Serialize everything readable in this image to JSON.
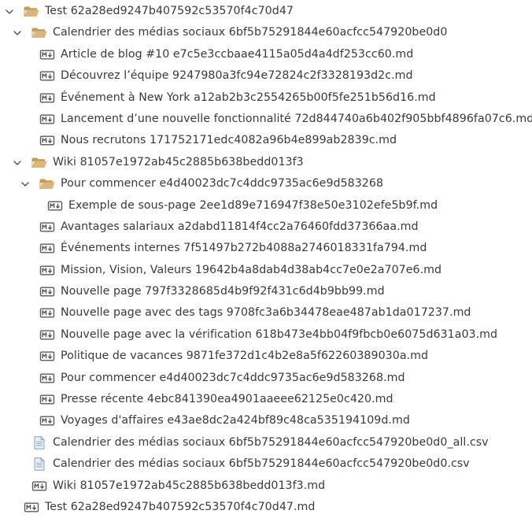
{
  "tree": [
    {
      "label": "Test 62a28ed9247b407592c53570f4c70d47",
      "type": "folder",
      "level": 0,
      "expanded": true,
      "chevron": "chevron-down-icon"
    },
    {
      "label": "Calendrier des médias sociaux 6bf5b75291844e60acfcc547920be0d0",
      "type": "folder",
      "level": 1,
      "expanded": true,
      "chevron": "chevron-down-icon"
    },
    {
      "label": "Article de blog #10 e7c5e3ccbaae4115a05d4a4df253cc60.md",
      "type": "markdown",
      "level": 2
    },
    {
      "label": "Découvrez l’équipe 9247980a3fc94e72824c2f3328193d2c.md",
      "type": "markdown",
      "level": 2
    },
    {
      "label": "Événement à New York a12ab2b3c2554265b00f5fe251b56d16.md",
      "type": "markdown",
      "level": 2
    },
    {
      "label": "Lancement d’une nouvelle fonctionnalité 72d844740a6b402f905bbf4896fa07c6.md",
      "type": "markdown",
      "level": 2
    },
    {
      "label": "Nous recrutons 171752171edc4082a96b4e899ab2839c.md",
      "type": "markdown",
      "level": 2
    },
    {
      "label": "Wiki 81057e1972ab45c2885b638bedd013f3",
      "type": "folder",
      "level": 1,
      "expanded": true,
      "chevron": "chevron-down-icon"
    },
    {
      "label": "Pour commencer e4d40023dc7c4ddc9735ac6e9d583268",
      "type": "folder",
      "level": 2,
      "expanded": true,
      "chevron": "chevron-down-icon"
    },
    {
      "label": "Exemple de sous-page 2ee1d89e716947f38e50e3102efe5b9f.md",
      "type": "markdown",
      "level": 3
    },
    {
      "label": "Avantages salariaux a2dabd11814f4cc2a76460fdd37366aa.md",
      "type": "markdown",
      "level": 2
    },
    {
      "label": "Événements internes 7f51497b272b4088a2746018331fa794.md",
      "type": "markdown",
      "level": 2
    },
    {
      "label": "Mission, Vision, Valeurs 19642b4a8dab4d38ab4cc7e0e2a707e6.md",
      "type": "markdown",
      "level": 2
    },
    {
      "label": "Nouvelle page 797f3328685d4b9f92f431c6d4b9bb99.md",
      "type": "markdown",
      "level": 2
    },
    {
      "label": "Nouvelle page avec des tags 9708fc3a6b34478eae487ab1da017237.md",
      "type": "markdown",
      "level": 2
    },
    {
      "label": "Nouvelle page avec la vérification 618b473e4bb04f9fbcb0e6075d631a03.md",
      "type": "markdown",
      "level": 2
    },
    {
      "label": "Politique de vacances 9871fe372d1c4b2e8a5f62260389030a.md",
      "type": "markdown",
      "level": 2
    },
    {
      "label": "Pour commencer e4d40023dc7c4ddc9735ac6e9d583268.md",
      "type": "markdown",
      "level": 2
    },
    {
      "label": "Presse récente 4ebc841390ea4901aaeee62125e0c420.md",
      "type": "markdown",
      "level": 2
    },
    {
      "label": "Voyages d'affaires e43ae8dc2a424bf89c48ca535194109d.md",
      "type": "markdown",
      "level": 2
    },
    {
      "label": "Calendrier des médias sociaux 6bf5b75291844e60acfcc547920be0d0_all.csv",
      "type": "csv",
      "level": 1
    },
    {
      "label": "Calendrier des médias sociaux 6bf5b75291844e60acfcc547920be0d0.csv",
      "type": "csv",
      "level": 1
    },
    {
      "label": "Wiki 81057e1972ab45c2885b638bedd013f3.md",
      "type": "markdown",
      "level": 1
    },
    {
      "label": "Test 62a28ed9247b407592c53570f4c70d47.md",
      "type": "markdown",
      "level": 0
    }
  ],
  "colors": {
    "folder": "#dcb67a",
    "folder_dark": "#c79a4f",
    "markdown": "#5a5a5a",
    "csv_page": "#e8eef6",
    "csv_border": "#8aa2c2",
    "text": "#3a3a3a",
    "chevron": "#4a4a4a"
  }
}
